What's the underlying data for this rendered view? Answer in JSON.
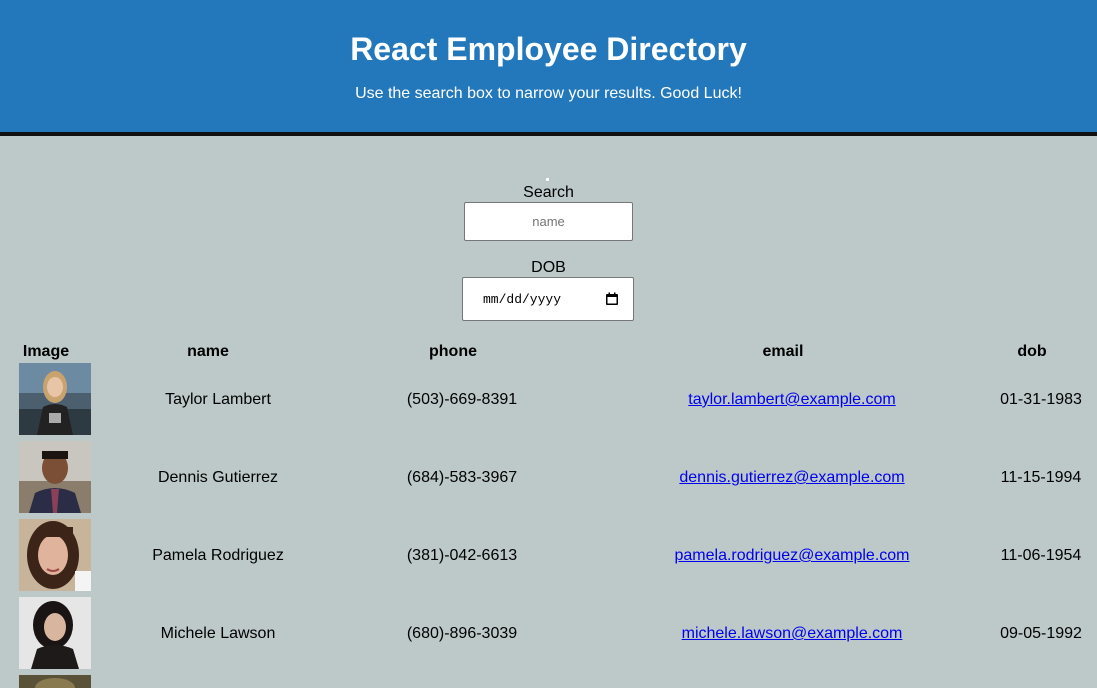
{
  "header": {
    "title": "React Employee Directory",
    "subtitle": "Use the search box to narrow your results. Good Luck!"
  },
  "search": {
    "label": "Search",
    "placeholder": "name",
    "value": ""
  },
  "dob_filter": {
    "label": "DOB",
    "value_display": "mm/dd/yyyy",
    "icon": "calendar-icon"
  },
  "table": {
    "columns": [
      "Image",
      "name",
      "phone",
      "email",
      "dob"
    ],
    "rows": [
      {
        "image": "portrait-photo",
        "name": "Taylor Lambert",
        "phone": "(503)-669-8391",
        "email": "taylor.lambert@example.com",
        "dob": "01-31-1983"
      },
      {
        "image": "portrait-photo",
        "name": "Dennis Gutierrez",
        "phone": "(684)-583-3967",
        "email": "dennis.gutierrez@example.com",
        "dob": "11-15-1994"
      },
      {
        "image": "portrait-photo",
        "name": "Pamela Rodriguez",
        "phone": "(381)-042-6613",
        "email": "pamela.rodriguez@example.com",
        "dob": "11-06-1954"
      },
      {
        "image": "portrait-photo",
        "name": "Michele Lawson",
        "phone": "(680)-896-3039",
        "email": "michele.lawson@example.com",
        "dob": "09-05-1992"
      }
    ]
  },
  "colors": {
    "header_bg": "#2378bb",
    "page_bg": "#bdc8c8",
    "link": "#0000ee"
  }
}
